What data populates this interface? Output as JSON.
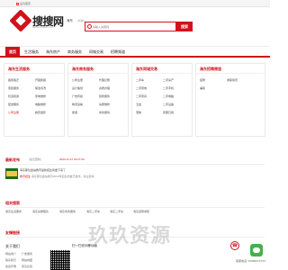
{
  "topbar": {
    "set_home": "设为首页"
  },
  "logo": {
    "name": "搜搜网",
    "url": "www.shsoso.com"
  },
  "city": {
    "name": "海东",
    "switch": "[切换]"
  },
  "search": {
    "placeholder": "请输入关键词",
    "button": "搜索"
  },
  "nav": [
    "首页",
    "生活服务",
    "海东房产",
    "商务服务",
    "同城交易",
    "招聘频道"
  ],
  "categories": [
    {
      "title": "海东生活服务",
      "links": [
        "搬家搬迁",
        "开锁换锁",
        "家政服务",
        "保洁清洗",
        "管道疏通",
        "家电维修",
        "配送服务",
        "电脑维修",
        "公司注册",
        "婚庆摄影"
      ]
    },
    {
      "title": "海东商务服务",
      "links": [
        "公司注册",
        "代理记账",
        "设计策划",
        "资质办理",
        "广告传媒",
        "装修服务",
        "物流运输",
        "房屋维修",
        "旅游",
        "商务服务"
      ]
    },
    {
      "title": "海东同城交易",
      "links": [
        "二手车",
        "二手房产",
        "二手家电",
        "二手手机",
        "二手家具",
        "二手电脑",
        "五金",
        "二手设备",
        "宠物",
        "家居日用"
      ]
    },
    {
      "title": "海东招聘频道",
      "links": [
        "招聘",
        "求职简历",
        "兼职"
      ]
    }
  ],
  "news": {
    "title": "最新发布",
    "sub": "(最近更新)",
    "date": "2023-11-27 23:27:00",
    "item_title": "海东那位鑫站教育最新招生简章下来了",
    "item_tag": "教育招生",
    "item_desc": "海东那位鑫站教育2023年招生简章已发布，欢迎咨询"
  },
  "related": {
    "title": "相关搜索",
    "links": [
      "海东生活服务",
      "海东房屋租赁",
      "海东商务服务",
      "海东二手车",
      "海东二手房",
      "海东招聘求职"
    ]
  },
  "friends": {
    "title": "友情链接"
  },
  "footer": {
    "about_title": "关于我们",
    "about_links": [
      "网站简介",
      "广告服务",
      "联系我们",
      "网站地图",
      "免责声明",
      "意见反馈"
    ],
    "qr_title": "扫一扫访问移动版",
    "phone": "客服电话: 1509567XXXX"
  },
  "watermark": "玖玖资源"
}
